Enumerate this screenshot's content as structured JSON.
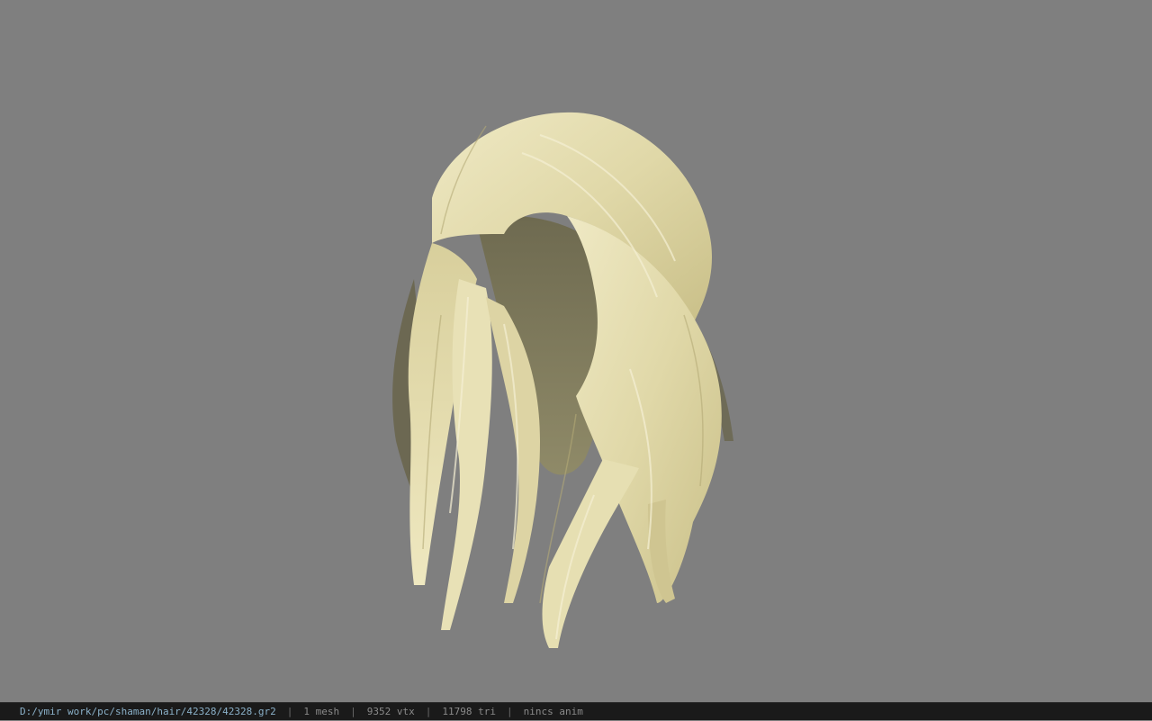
{
  "viewport": {
    "background_color": "#7f7f7f",
    "model": {
      "icon": "hair-mesh",
      "hair_color": "#e6e0b4"
    }
  },
  "statusbar": {
    "file_path": "D:/ymir work/pc/shaman/hair/42328/42328.gr2",
    "separator": "|",
    "mesh_count": "1 mesh",
    "vertex_count": "9352 vtx",
    "triangle_count": "11798 tri",
    "anim_status": "nincs anim"
  }
}
